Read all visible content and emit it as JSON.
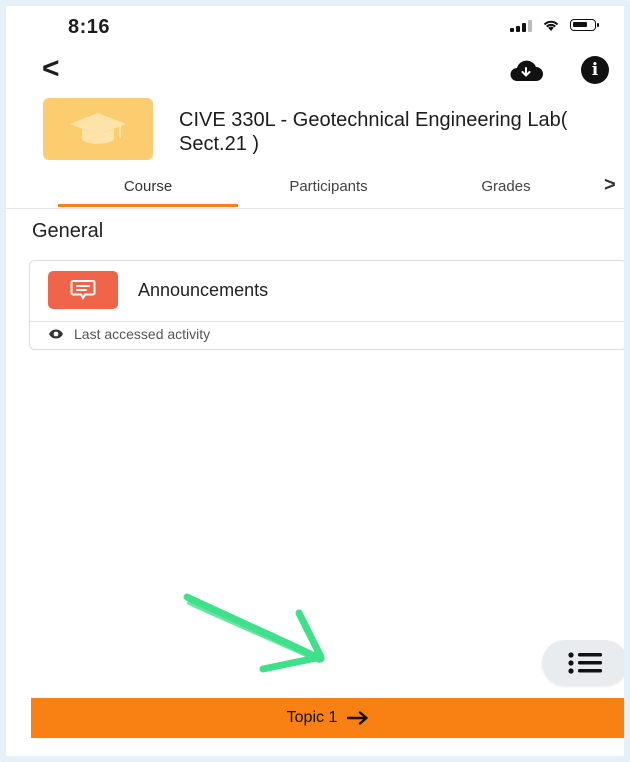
{
  "status": {
    "time": "8:16"
  },
  "course": {
    "title": "CIVE 330L - Geotechnical Engineering Lab( Sect.21 )"
  },
  "tabs": [
    {
      "label": "Course"
    },
    {
      "label": "Participants"
    },
    {
      "label": "Grades"
    }
  ],
  "section": {
    "title": "General"
  },
  "activity": {
    "name": "Announcements",
    "last_accessed": "Last accessed activity"
  },
  "footer": {
    "next_topic": "Topic 1"
  },
  "colors": {
    "accent": "#f98012",
    "course_icon": "#fbcd6e",
    "forum_icon": "#f0654a",
    "annotation": "#3ee08a"
  },
  "icons": [
    "back-chevron-icon",
    "download-cloud-icon",
    "info-icon",
    "graduation-cap-icon",
    "forum-icon",
    "eye-icon",
    "list-icon",
    "arrow-right-icon",
    "chevron-right-icon"
  ]
}
